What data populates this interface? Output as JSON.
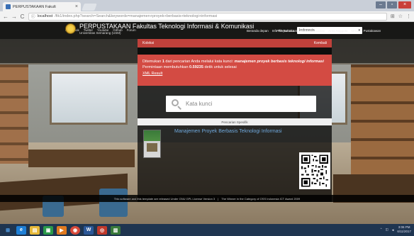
{
  "browser": {
    "tab_title": "PERPUSTAKAAN Fakult",
    "tab_close": "×",
    "url_host": "localhost",
    "url_path": "/fik1/index.php?search=Search&keywords=manajemen+proyek+berbasis+teknologi+informasi",
    "info_icon": "ⓘ"
  },
  "topnav": {
    "links": [
      "Facebook",
      "Twitter",
      "Youtube",
      "Github",
      "Forum"
    ],
    "select_label": "Pilih Bahasa",
    "select_value": "Indonesia"
  },
  "header": {
    "title": "PERPUSTAKAAN Fakultas Teknologi Informasi & Komunikasi",
    "subtitle": "Universitas Semarang (USM)",
    "nav": [
      "Beranda depan",
      "Info Perpustakaan",
      "Berita pencarian",
      "Area Anggota",
      "MASUK Pustakawan"
    ]
  },
  "panel": {
    "head_left": "Koleksi",
    "head_right": "Kembali",
    "alert_prefix": "Ditemukan ",
    "alert_count": "1",
    "alert_mid": " dari pencarian Anda melalui kata kunci: ",
    "alert_keyword": "manajemen proyek berbasis teknologi informasi",
    "alert_time_prefix": "Permintaan membutuhkan ",
    "alert_time": "0.59235",
    "alert_time_suffix": " detik untuk selesai",
    "xml_link": "XML Result",
    "search_placeholder": "Kata kunci",
    "spesifik_label": "Pencarian Spesifik",
    "result_title": "Manajemen Proyek Berbasis Teknologi Informasi"
  },
  "footer": {
    "left": "This software and this template are released Under GNU GPL License Version 3",
    "sep": "|",
    "right": "The Winner in the Category of OSS Indonesia ICT Award 2009"
  },
  "taskbar": {
    "time": "3:06 PM",
    "date": "6/11/2017"
  },
  "colors": {
    "accent_red": "#d34b43",
    "link_blue": "#6fa8dc",
    "taskbar": "#1f3550"
  }
}
